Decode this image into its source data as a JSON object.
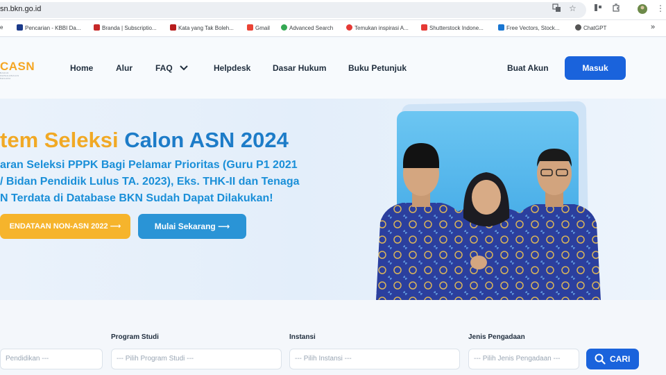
{
  "browser": {
    "url": "sn.bkn.go.id",
    "bookmarks": [
      {
        "label": "e",
        "color": "#4a6fb5"
      },
      {
        "label": "Pencarian - KBBI Da...",
        "color": "#1b3a8a"
      },
      {
        "label": "Branda | Subscriptio...",
        "color": "#c62828"
      },
      {
        "label": "Kata yang Tak Boleh...",
        "color": "#b71c1c"
      },
      {
        "label": "Gmail",
        "color": "#ea4335"
      },
      {
        "label": "Advanced Search",
        "color": "#34a853"
      },
      {
        "label": "Temukan inspirasi A...",
        "color": "#e53935"
      },
      {
        "label": "Shutterstock Indone...",
        "color": "#e53935"
      },
      {
        "label": "Free Vectors, Stock...",
        "color": "#1976d2"
      },
      {
        "label": "ChatGPT",
        "color": "#555555"
      }
    ],
    "more_bookmarks_glyph": "»"
  },
  "site": {
    "logo_text": "CASN",
    "logo_tagline": "BADAN KEPEGAWAIAN NEGARA",
    "nav": {
      "home": "Home",
      "alur": "Alur",
      "faq": "FAQ",
      "helpdesk": "Helpdesk",
      "dasar_hukum": "Dasar Hukum",
      "buku_petunjuk": "Buku Petunjuk"
    },
    "buat_akun": "Buat Akun",
    "masuk": "Masuk"
  },
  "hero": {
    "title_part1": "tem Seleksi",
    "title_part2": "Calon ASN 2024",
    "subtitle_line1": "aran Seleksi PPPK Bagi Pelamar Prioritas (Guru P1 2021",
    "subtitle_line2": "/ Bidan Pendidik Lulus TA. 2023), Eks. THK-II dan Tenaga",
    "subtitle_line3": "N Terdata di Database BKN Sudah Dapat Dilakukan!",
    "btn_pendataan": "ENDATAAN NON-ASN 2022",
    "btn_mulai": "Mulai Sekarang"
  },
  "filters": {
    "pendidikan_placeholder": "Pendidikan ---",
    "program_studi_label": "Program Studi",
    "program_studi_placeholder": "--- Pilih Program Studi ---",
    "instansi_label": "Instansi",
    "instansi_placeholder": "--- Pilih Instansi ---",
    "jenis_label": "Jenis Pengadaan",
    "jenis_placeholder": "--- Pilih Jenis Pengadaan ---",
    "cari": "CARI"
  },
  "colors": {
    "primary_blue": "#1a63dc",
    "accent_orange": "#f1a925",
    "title_blue": "#1d7cc8",
    "batik_blue": "#2b3f9e"
  }
}
